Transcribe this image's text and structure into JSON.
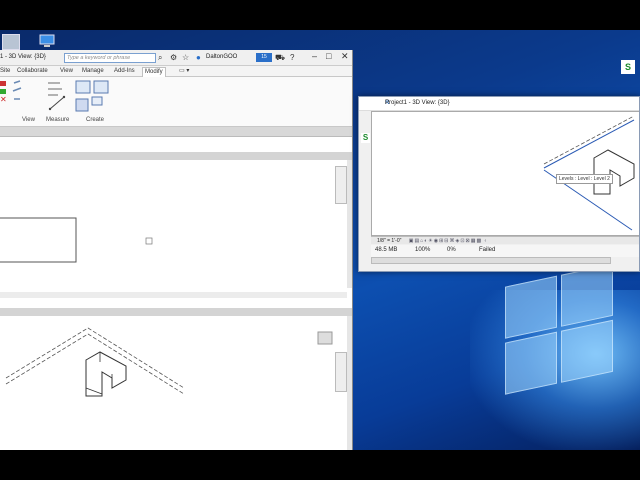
{
  "main_window": {
    "title_fragment": "1 - 3D View: {3D}",
    "search_placeholder": "Type a keyword or phrase",
    "user_name": "DaltonGOO",
    "badge_text": "15",
    "tabs": [
      {
        "label": "Site",
        "active": false
      },
      {
        "label": "Collaborate",
        "active": false
      },
      {
        "label": "View",
        "active": false
      },
      {
        "label": "Manage",
        "active": false
      },
      {
        "label": "Add-Ins",
        "active": false
      },
      {
        "label": "Modify",
        "active": true
      }
    ],
    "ribbon_groups": [
      "View",
      "Measure",
      "Create"
    ]
  },
  "float_window": {
    "title": "Project1 - 3D View: {3D}",
    "tooltip": "Levels : Level : Level 2",
    "scale": "1/8\" = 1'-0\"",
    "row": {
      "memory": "48.5 MB",
      "percent1": "100%",
      "percent2": "0%",
      "status": "Failed"
    }
  },
  "desktop": {
    "icon_label": "S"
  },
  "colors": {
    "accent": "#1a5fb4",
    "desktop": "#0b3a8c",
    "model_line": "#2a5ab4"
  }
}
